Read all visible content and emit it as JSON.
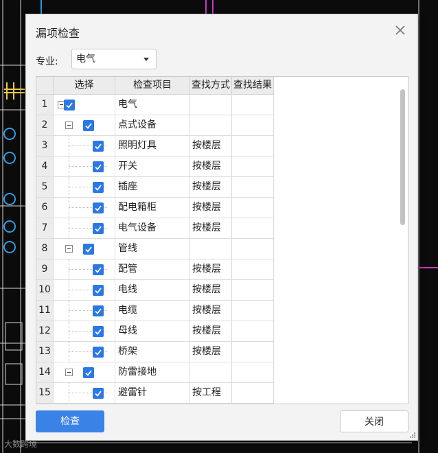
{
  "dialog": {
    "title": "漏项检查",
    "specialty_label": "专业:",
    "specialty_value": "电气",
    "check_button": "检查",
    "close_button": "关闭"
  },
  "grid": {
    "headers": [
      "选择",
      "检查项目",
      "查找方式",
      "查找结果"
    ],
    "rows": [
      {
        "num": "1",
        "item": "电气",
        "method": "",
        "level": 0
      },
      {
        "num": "2",
        "item": "点式设备",
        "method": "",
        "level": 1
      },
      {
        "num": "3",
        "item": "照明灯具",
        "method": "按楼层",
        "level": 2
      },
      {
        "num": "4",
        "item": "开关",
        "method": "按楼层",
        "level": 2
      },
      {
        "num": "5",
        "item": "插座",
        "method": "按楼层",
        "level": 2
      },
      {
        "num": "6",
        "item": "配电箱柜",
        "method": "按楼层",
        "level": 2
      },
      {
        "num": "7",
        "item": "电气设备",
        "method": "按楼层",
        "level": 2
      },
      {
        "num": "8",
        "item": "管线",
        "method": "",
        "level": 1
      },
      {
        "num": "9",
        "item": "配管",
        "method": "按楼层",
        "level": 2
      },
      {
        "num": "10",
        "item": "电线",
        "method": "按楼层",
        "level": 2
      },
      {
        "num": "11",
        "item": "电缆",
        "method": "按楼层",
        "level": 2
      },
      {
        "num": "12",
        "item": "母线",
        "method": "按楼层",
        "level": 2
      },
      {
        "num": "13",
        "item": "桥架",
        "method": "按楼层",
        "level": 2
      },
      {
        "num": "14",
        "item": "防雷接地",
        "method": "",
        "level": 1
      },
      {
        "num": "15",
        "item": "避雷针",
        "method": "按工程",
        "level": 2
      }
    ]
  },
  "watermark": "大数跨境",
  "colors": {
    "accent": "#3b82e6",
    "checkbox": "#2b78e4"
  }
}
